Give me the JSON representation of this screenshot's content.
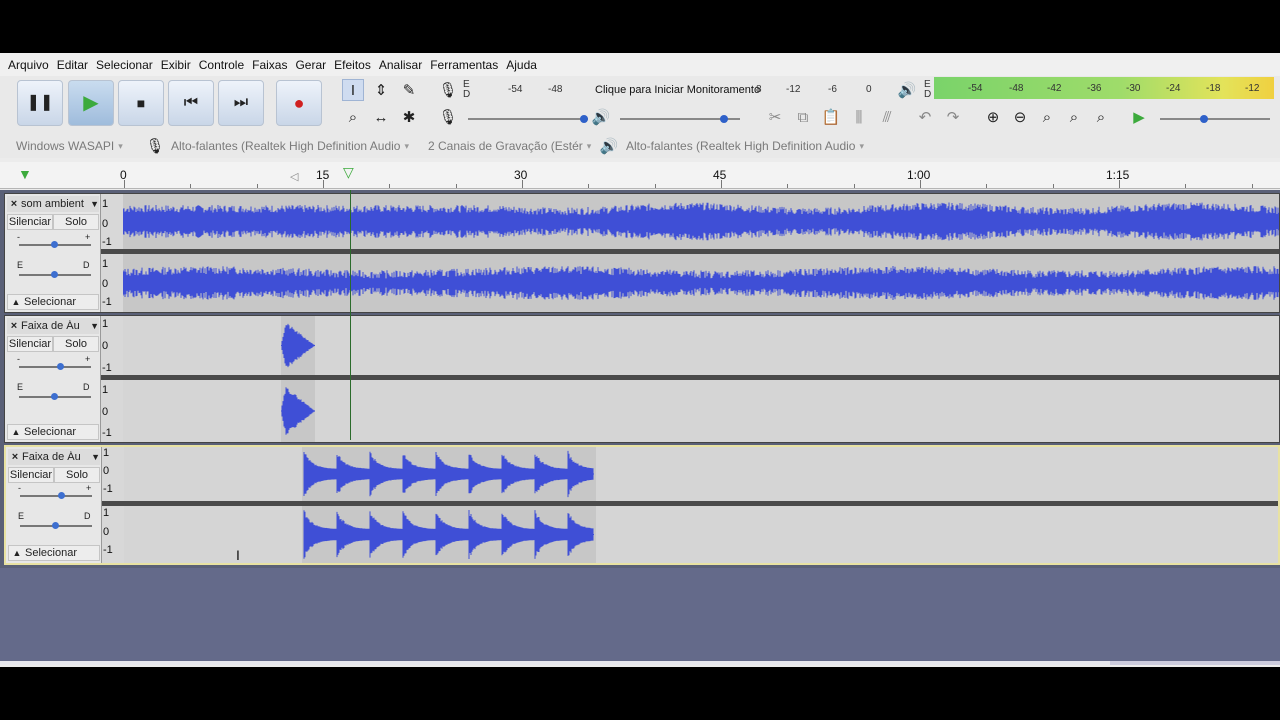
{
  "menu": [
    "Arquivo",
    "Editar",
    "Selecionar",
    "Exibir",
    "Controle",
    "Faixas",
    "Gerar",
    "Efeitos",
    "Analisar",
    "Ferramentas",
    "Ajuda"
  ],
  "transport": {
    "pause_icon": "pause-icon",
    "play_icon": "play-icon",
    "stop_icon": "stop-icon",
    "skip_start_icon": "skip-start-icon",
    "skip_end_icon": "skip-end-icon",
    "record_icon": "record-icon"
  },
  "recording_meter": {
    "scale": [
      "-54",
      "-48",
      "-12",
      "-6",
      "0"
    ],
    "prompt": "Clique para Iniciar Monitoramento",
    "prompt_suffix": "8",
    "channels": [
      "E",
      "D"
    ]
  },
  "playback_meter": {
    "scale": [
      "-54",
      "-48",
      "-42",
      "-36",
      "-30",
      "-24",
      "-18",
      "-12"
    ],
    "channels": [
      "E",
      "D"
    ]
  },
  "devices": {
    "host": "Windows WASAPI",
    "input": "Alto-falantes (Realtek High Definition Audio",
    "channels": "2 Canais de  Gravação (Estér",
    "output": "Alto-falantes (Realtek High Definition Audio"
  },
  "ruler": [
    "0",
    "15",
    "30",
    "45",
    "1:00",
    "1:15"
  ],
  "tracks": [
    {
      "name": "som ambient",
      "mute": "Silenciar",
      "solo": "Solo",
      "select": "Selecionar",
      "left": "E",
      "right": "D",
      "scale": [
        "1",
        "0",
        "-1"
      ]
    },
    {
      "name": "Faixa de Áu",
      "mute": "Silenciar",
      "solo": "Solo",
      "select": "Selecionar",
      "left": "E",
      "right": "D",
      "scale": [
        "1",
        "0",
        "-1"
      ]
    },
    {
      "name": "Faixa de Áu",
      "mute": "Silenciar",
      "solo": "Solo",
      "select": "Selecionar",
      "left": "E",
      "right": "D",
      "scale": [
        "1",
        "0",
        "-1"
      ]
    }
  ],
  "colors": {
    "waveform": "#3f4fd6",
    "record": "#d02020",
    "play": "#3caa3c"
  }
}
